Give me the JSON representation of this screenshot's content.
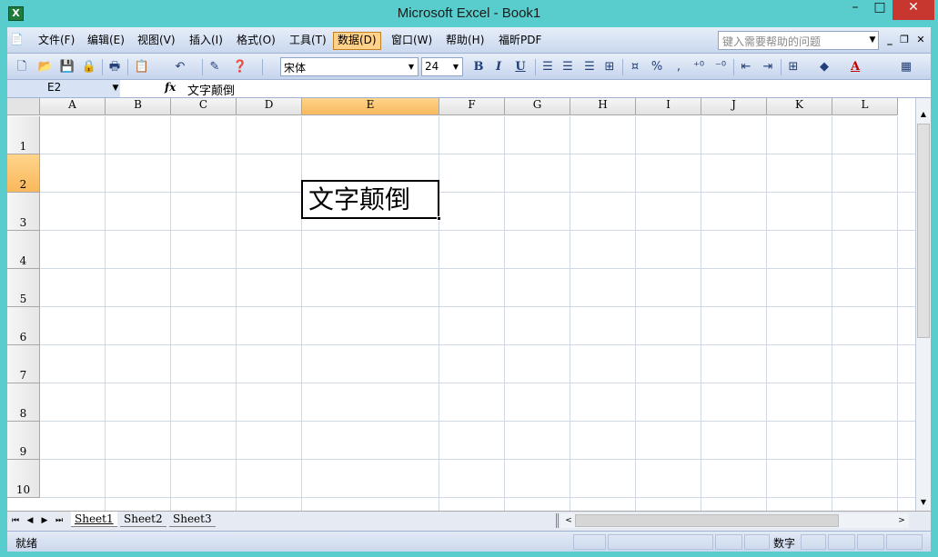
{
  "window": {
    "title": "Microsoft Excel - Book1",
    "app_icon": "excel-icon",
    "controls": {
      "minimize": "–",
      "maximize": "□",
      "close": "✕"
    }
  },
  "menubar": {
    "items": [
      {
        "label": "文件(F)"
      },
      {
        "label": "编辑(E)"
      },
      {
        "label": "视图(V)"
      },
      {
        "label": "插入(I)"
      },
      {
        "label": "格式(O)"
      },
      {
        "label": "工具(T)"
      },
      {
        "label": "数据(D)",
        "active": true
      },
      {
        "label": "窗口(W)"
      },
      {
        "label": "帮助(H)"
      },
      {
        "label": "福昕PDF"
      }
    ],
    "help_placeholder": "键入需要帮助的问题"
  },
  "toolbar": {
    "font_name": "宋体",
    "font_size": "24",
    "bold": "B",
    "italic": "I",
    "underline": "U",
    "percent": "%",
    "comma": ",",
    "font_color_letter": "A"
  },
  "formula_bar": {
    "name_box": "E2",
    "fx": "fx",
    "value": "文字颠倒"
  },
  "grid": {
    "columns": [
      "A",
      "B",
      "C",
      "D",
      "E",
      "F",
      "G",
      "H",
      "I",
      "J",
      "K",
      "L"
    ],
    "rows": [
      "1",
      "2",
      "3",
      "4",
      "5",
      "6",
      "7",
      "8",
      "9",
      "10"
    ],
    "selected_column": "E",
    "selected_row": "2",
    "cell_e2": "文字颠倒"
  },
  "sheets": {
    "tabs": [
      "Sheet1",
      "Sheet2",
      "Sheet3"
    ],
    "active": "Sheet1"
  },
  "status": {
    "text": "就绪",
    "mode": "数字"
  }
}
